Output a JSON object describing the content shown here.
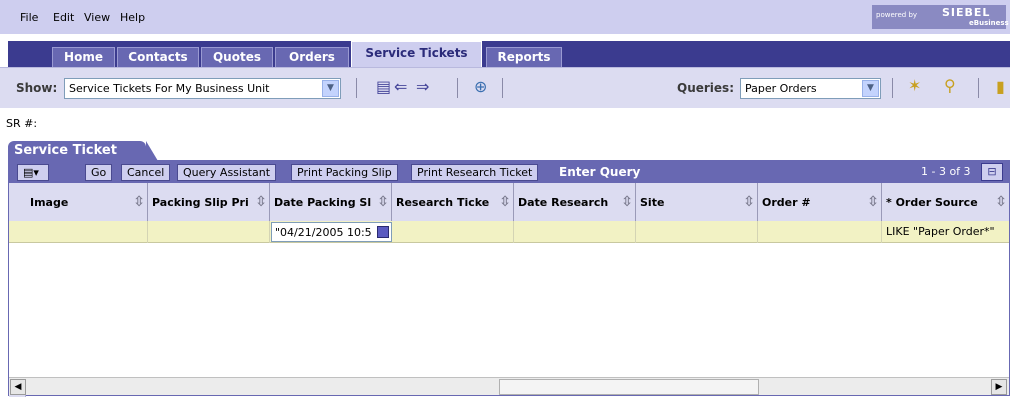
{
  "menu": {
    "items": [
      "File",
      "Edit",
      "View",
      "Help"
    ]
  },
  "brand": {
    "powered_by": "powered by",
    "name": "SIEBEL",
    "sub": "eBusiness"
  },
  "tabs": [
    {
      "label": "Home"
    },
    {
      "label": "Contacts"
    },
    {
      "label": "Quotes"
    },
    {
      "label": "Orders"
    },
    {
      "label": "Service Tickets",
      "active": true
    },
    {
      "label": "Reports"
    }
  ],
  "showbar": {
    "show_label": "Show:",
    "show_value": "Service Tickets For My Business Unit",
    "queries_label": "Queries:",
    "queries_value": "Paper Orders"
  },
  "sr_label": "SR #:",
  "applet": {
    "title": "Service Ticket",
    "buttons": {
      "go": "Go",
      "cancel": "Cancel",
      "query_assistant": "Query Assistant",
      "print_packing": "Print Packing Slip",
      "print_research": "Print Research Ticket"
    },
    "mode": "Enter Query",
    "record_count": "1 - 3 of 3"
  },
  "columns": [
    {
      "label": "Image"
    },
    {
      "label": "Packing Slip Pri"
    },
    {
      "label": "Date Packing Sl"
    },
    {
      "label": "Research Ticke"
    },
    {
      "label": "Date Research"
    },
    {
      "label": "Site"
    },
    {
      "label": "Order #"
    },
    {
      "label": "* Order Source"
    }
  ],
  "query_row": {
    "date_packing": "\"04/21/2005 10:5",
    "order_source": "LIKE \"Paper Order*\""
  },
  "colors": {
    "tab_active_text": "#2b2b7a",
    "applet_bar": "#6868b2",
    "query_row_bg": "#f2f2c4"
  }
}
